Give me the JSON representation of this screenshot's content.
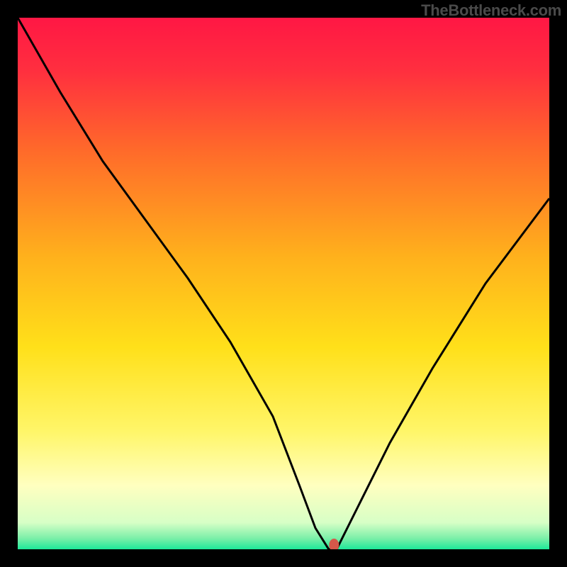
{
  "watermark": "TheBottleneck.com",
  "chart_data": {
    "type": "line",
    "title": "",
    "xlabel": "",
    "ylabel": "",
    "xlim": [
      0,
      100
    ],
    "ylim": [
      0,
      100
    ],
    "curve": {
      "x": [
        0,
        8,
        16,
        24,
        32,
        40,
        48,
        53,
        56,
        58.5,
        60,
        64,
        70,
        78,
        88,
        100
      ],
      "percent": [
        100,
        86,
        73,
        62,
        51,
        39,
        25,
        12,
        4,
        0,
        0,
        8,
        20,
        34,
        50,
        66
      ]
    },
    "marker": {
      "x": 59.5,
      "percent": 0
    },
    "gradient_stops": [
      {
        "offset": 0.0,
        "color": "#ff1744"
      },
      {
        "offset": 0.1,
        "color": "#ff2f3f"
      },
      {
        "offset": 0.25,
        "color": "#ff6a2a"
      },
      {
        "offset": 0.45,
        "color": "#ffb11c"
      },
      {
        "offset": 0.62,
        "color": "#ffe01a"
      },
      {
        "offset": 0.78,
        "color": "#fff66a"
      },
      {
        "offset": 0.88,
        "color": "#ffffc0"
      },
      {
        "offset": 0.95,
        "color": "#d7ffc6"
      },
      {
        "offset": 0.98,
        "color": "#79efa8"
      },
      {
        "offset": 1.0,
        "color": "#1de89a"
      }
    ],
    "marker_color": "#d4584a",
    "line_color": "#000000"
  }
}
